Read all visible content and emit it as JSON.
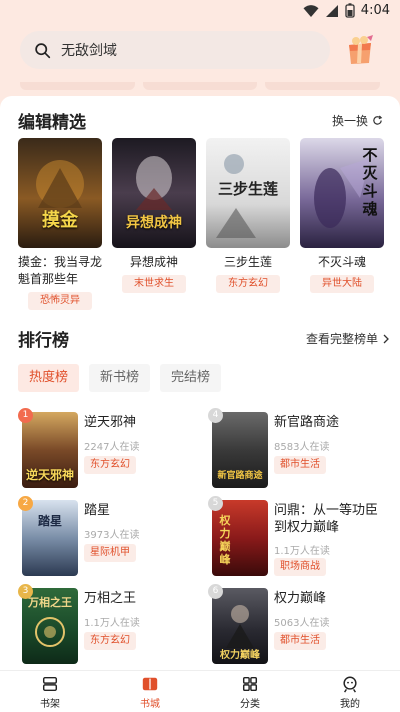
{
  "status": {
    "time": "4:04"
  },
  "search": {
    "placeholder_value": "无敌剑域"
  },
  "editor_picks": {
    "title": "编辑精选",
    "refresh_label": "换一换",
    "books": [
      {
        "title": "摸金：我当寻龙魁首那些年",
        "tag": "恐怖灵异",
        "cover_text": "摸金"
      },
      {
        "title": "异想成神",
        "tag": "末世求生",
        "cover_text": "异想成神"
      },
      {
        "title": "三步生莲",
        "tag": "东方玄幻",
        "cover_text": "三步生莲"
      },
      {
        "title": "不灭斗魂",
        "tag": "异世大陆",
        "cover_text": "不灭斗魂"
      }
    ]
  },
  "ranking": {
    "title": "排行榜",
    "view_all_label": "查看完整榜单",
    "tabs": [
      "热度榜",
      "新书榜",
      "完结榜"
    ],
    "active_tab": 0,
    "books": [
      {
        "rank": "1",
        "title": "逆天邪神",
        "readers": "2247人在读",
        "tag": "东方玄幻",
        "cover_text": "逆天邪神"
      },
      {
        "rank": "4",
        "title": "新官路商途",
        "readers": "8583人在读",
        "tag": "都市生活",
        "cover_text": "新官路商途"
      },
      {
        "rank": "2",
        "title": "踏星",
        "readers": "3973人在读",
        "tag": "星际机甲",
        "cover_text": "踏星"
      },
      {
        "rank": "5",
        "title": "问鼎：从一等功臣到权力巅峰",
        "readers": "1.1万人在读",
        "tag": "职场商战",
        "cover_text": "权力巅峰"
      },
      {
        "rank": "3",
        "title": "万相之王",
        "readers": "1.1万人在读",
        "tag": "东方玄幻",
        "cover_text": "万相之王"
      },
      {
        "rank": "6",
        "title": "权力巅峰",
        "readers": "5063人在读",
        "tag": "都市生活",
        "cover_text": "权力巅峰"
      }
    ]
  },
  "bottom_nav": [
    {
      "label": "书架",
      "icon": "bookshelf-icon"
    },
    {
      "label": "书城",
      "icon": "book-open-icon"
    },
    {
      "label": "分类",
      "icon": "grid-icon"
    },
    {
      "label": "我的",
      "icon": "profile-icon"
    }
  ],
  "colors": {
    "accent": "#e0502b",
    "background": "#fde9e1"
  }
}
